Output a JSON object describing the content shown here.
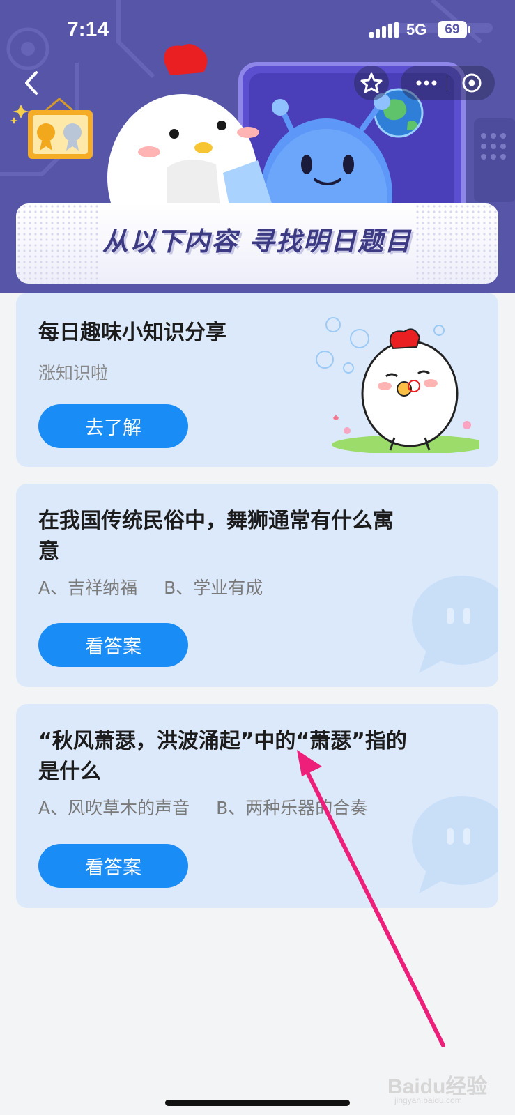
{
  "status_bar": {
    "time": "7:14",
    "network": "5G",
    "battery": "69"
  },
  "header": {
    "back_icon": "chevron-left-icon",
    "favorite_icon": "star-icon",
    "more_icon": "more-dots-icon",
    "close_icon": "target-circle-icon"
  },
  "banner": {
    "title": "从以下内容 寻找明日题目"
  },
  "cards": [
    {
      "title": "每日趣味小知识分享",
      "subtitle": "涨知识啦",
      "button": "去了解"
    },
    {
      "title_line1": "在我国传统民俗中，舞狮通常有什么寓",
      "title_line2": "意",
      "option_a": "A、吉祥纳福",
      "option_b": "B、学业有成",
      "button": "看答案"
    },
    {
      "title_line1": "“秋风萧瑟，洪波涌起”中的“萧瑟”指的",
      "title_line2": "是什么",
      "option_a": "A、风吹草木的声音",
      "option_b": "B、两种乐器的合奏",
      "button": "看答案"
    }
  ],
  "watermark": {
    "brand": "Baidu经验",
    "domain": "jingyan.baidu.com"
  },
  "colors": {
    "hero": "#5655a8",
    "card": "#dbe9fb",
    "button": "#1a8cf5",
    "arrow": "#ee1f7a"
  }
}
